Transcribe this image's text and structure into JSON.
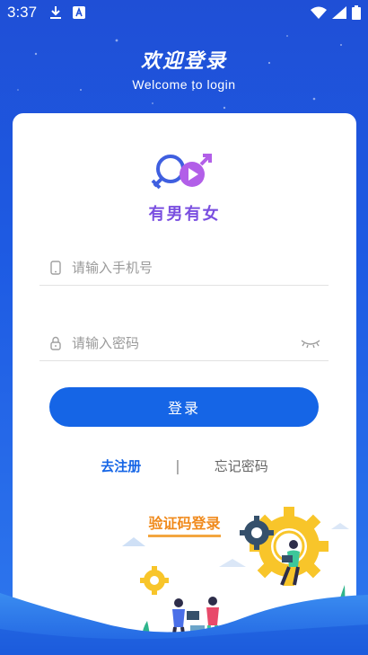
{
  "status_bar": {
    "time": "3:37"
  },
  "header": {
    "title": "欢迎登录",
    "subtitle": "Welcome to login"
  },
  "logo": {
    "text": "有男有女"
  },
  "form": {
    "phone_placeholder": "请输入手机号",
    "password_placeholder": "请输入密码",
    "login_label": "登录"
  },
  "links": {
    "register": "去注册",
    "divider": "|",
    "forgot": "忘记密码"
  },
  "code_login": "验证码登录",
  "colors": {
    "primary": "#1565e6",
    "accent_orange": "#f08a1c",
    "background_top": "#1f4fd6",
    "logo_purple": "#7a4fe0"
  }
}
